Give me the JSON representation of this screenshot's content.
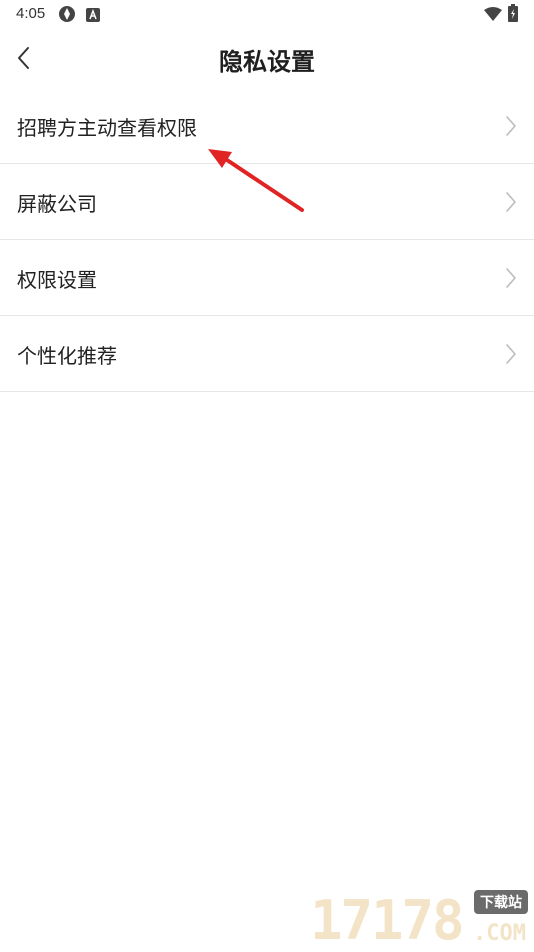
{
  "status_bar": {
    "time": "4:05",
    "icons": [
      "location-sync-icon",
      "text-a-icon",
      "wifi-icon",
      "battery-charging-icon"
    ]
  },
  "header": {
    "title": "隐私设置",
    "back_icon": "chevron-left-icon"
  },
  "menu": {
    "items": [
      {
        "label": "招聘方主动查看权限"
      },
      {
        "label": "屏蔽公司"
      },
      {
        "label": "权限设置"
      },
      {
        "label": "个性化推荐"
      }
    ]
  },
  "annotation": {
    "color": "#e02424"
  },
  "watermark": {
    "number": "17178",
    "badge": "下载站",
    "domain": ".COM"
  }
}
